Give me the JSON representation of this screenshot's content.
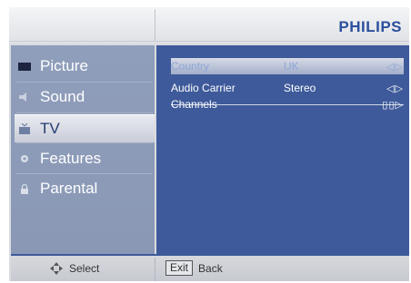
{
  "header": {
    "brand": "PHILIPS"
  },
  "sidebar": {
    "items": [
      {
        "label": "Picture",
        "icon": "picture-icon"
      },
      {
        "label": "Sound",
        "icon": "speaker-icon"
      },
      {
        "label": "TV",
        "icon": "tv-icon",
        "active": true
      },
      {
        "label": "Features",
        "icon": "gear-icon"
      },
      {
        "label": "Parental",
        "icon": "lock-icon"
      }
    ]
  },
  "content": {
    "rows": [
      {
        "label": "Country",
        "value": "UK",
        "arrows": "◁▷",
        "highlighted": true
      },
      {
        "label": "Audio Carrier",
        "value": "Stereo",
        "arrows": "◁▷"
      },
      {
        "label": "Channels",
        "value": "",
        "arrows": "▯▯▷"
      }
    ]
  },
  "footer": {
    "select_label": "Select",
    "exit_key": "Exit",
    "back_label": "Back"
  },
  "colors": {
    "accent": "#3e5a9a",
    "brand": "#2b4f9c",
    "sidebar": "#8f9ebb"
  }
}
